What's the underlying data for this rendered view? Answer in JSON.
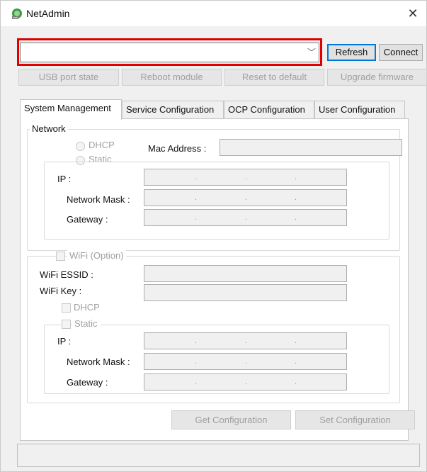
{
  "window": {
    "title": "NetAdmin",
    "close_glyph": "✕"
  },
  "connection": {
    "device_value": "",
    "refresh_label": "Refresh",
    "connect_label": "Connect"
  },
  "actions": {
    "usb_port_state": "USB port state",
    "reboot_module": "Reboot module",
    "reset_to_default": "Reset to default",
    "upgrade_firmware": "Upgrade firmware"
  },
  "tabs": [
    {
      "label": "System Management"
    },
    {
      "label": "Service Configuration"
    },
    {
      "label": "OCP Configuration"
    },
    {
      "label": "User Configuration"
    }
  ],
  "network": {
    "legend": "Network",
    "dhcp_label": "DHCP",
    "static_label": "Static",
    "mac_label": "Mac Address :",
    "mac_value": "",
    "ip_label": "IP :",
    "mask_label": "Network Mask :",
    "gateway_label": "Gateway :"
  },
  "wifi": {
    "legend": "WiFi (Option)",
    "essid_label": "WiFi ESSID :",
    "essid_value": "",
    "key_label": "WiFi Key :",
    "key_value": "",
    "dhcp_label": "DHCP",
    "static_label": "Static",
    "ip_label": "IP :",
    "mask_label": "Network Mask :",
    "gateway_label": "Gateway :"
  },
  "footer": {
    "get_configuration": "Get Configuration",
    "set_configuration": "Set Configuration",
    "status_text": ""
  },
  "colors": {
    "highlight": "#e00000",
    "focus": "#0078d7"
  }
}
